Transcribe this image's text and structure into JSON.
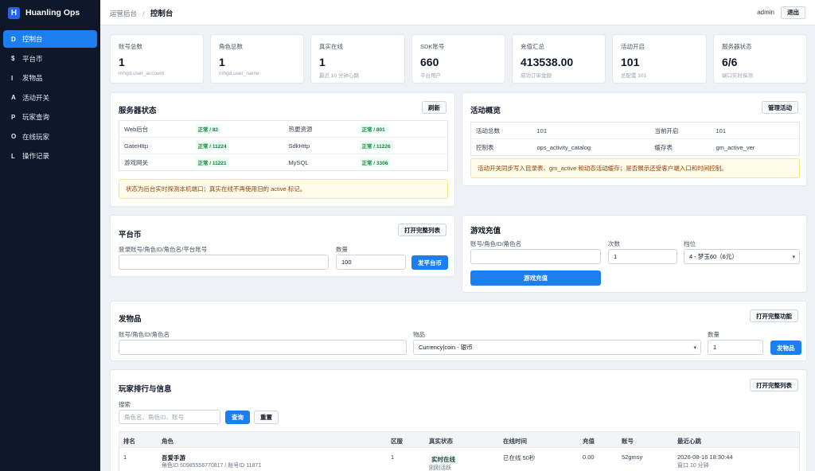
{
  "brand": {
    "logo": "H",
    "name": "Huanling Ops"
  },
  "nav": [
    {
      "letter": "D",
      "label": "控制台",
      "active": true
    },
    {
      "letter": "$",
      "label": "平台币"
    },
    {
      "letter": "I",
      "label": "发物品"
    },
    {
      "letter": "A",
      "label": "活动开关"
    },
    {
      "letter": "P",
      "label": "玩家查询"
    },
    {
      "letter": "O",
      "label": "在线玩家"
    },
    {
      "letter": "L",
      "label": "操作记录"
    }
  ],
  "header": {
    "crumb_root": "运营后台",
    "crumb_sep": "/",
    "crumb_current": "控制台",
    "user": "admin",
    "logout": "退出"
  },
  "stats": [
    {
      "label": "账号总数",
      "value": "1",
      "note": "mhgd.user_account"
    },
    {
      "label": "角色总数",
      "value": "1",
      "note": "mhgd.user_name"
    },
    {
      "label": "真实在线",
      "value": "1",
      "note": "最近 10 分钟心跳"
    },
    {
      "label": "SDK账号",
      "value": "660",
      "note": "平台用户"
    },
    {
      "label": "充值汇总",
      "value": "413538.00",
      "note": "成功订单金额"
    },
    {
      "label": "活动开启",
      "value": "101",
      "note": "总配置 101"
    },
    {
      "label": "服务器状态",
      "value": "6/6",
      "note": "端口实时探测"
    }
  ],
  "server_status": {
    "title": "服务器状态",
    "refresh": "刷新",
    "rows": [
      {
        "name1": "Web后台",
        "status1": "正常 / 82",
        "name2": "热更资源",
        "status2": "正常 / 801"
      },
      {
        "name1": "GateHttp",
        "status1": "正常 / 11224",
        "name2": "SdkHttp",
        "status2": "正常 / 11226"
      },
      {
        "name1": "游戏网关",
        "status1": "正常 / 11221",
        "name2": "MySQL",
        "status2": "正常 / 3306"
      }
    ],
    "notice": "状态为后台实时探测本机端口；真实在线不再使用旧的 active 标记。"
  },
  "activity": {
    "title": "活动概览",
    "manage": "管理活动",
    "rows": [
      {
        "k1": "活动总数",
        "v1": "101",
        "k2": "当前开启",
        "v2": "101"
      },
      {
        "k1": "控制表",
        "v1": "ops_activity_catalog",
        "k2": "缓存表",
        "v2": "gm_active_ver"
      }
    ],
    "notice": "活动开关同步写入目录表、gm_active 和动态活动缓存；是否展示还受客户端入口和时间控制。"
  },
  "platform_coin": {
    "title": "平台币",
    "open_list": "打开完整列表",
    "account_label": "登录账号/角色ID/角色名/平台账号",
    "account_value": "",
    "qty_label": "数量",
    "qty_value": "100",
    "submit": "发平台币"
  },
  "recharge": {
    "title": "游戏充值",
    "account_label": "账号/角色ID/角色名",
    "account_value": "",
    "count_label": "次数",
    "count_value": "1",
    "tier_label": "档位",
    "tier_value": "4 - 梦玉60（6元）",
    "submit": "游戏充值"
  },
  "send_item": {
    "title": "发物品",
    "open_full": "打开完整功能",
    "account_label": "账号/角色ID/角色名",
    "account_value": "",
    "item_label": "物品",
    "item_value": "Currency|coin - 银币",
    "qty_label": "数量",
    "qty_value": "1",
    "submit": "发物品"
  },
  "players": {
    "title": "玩家排行与信息",
    "open_list": "打开完整列表",
    "search_label": "搜索",
    "search_placeholder": "角色名、角色ID、账号",
    "query": "查询",
    "reset": "重置",
    "columns": [
      "排名",
      "角色",
      "区服",
      "真实状态",
      "在线时间",
      "充值",
      "账号",
      "最近心跳"
    ],
    "rows": [
      {
        "rank": "1",
        "name": "吾爱手游",
        "ids": "角色ID 50985556770817 / 账号ID 11871",
        "server": "1",
        "status": "实时在线",
        "status_sub": "刚刚活跃",
        "online_time": "已在线 50秒",
        "recharge": "0.00",
        "account": "52gmsy",
        "heartbeat": "2026-08-16 18:30:44",
        "heartbeat_sub": "窗口 10 分钟"
      }
    ]
  }
}
